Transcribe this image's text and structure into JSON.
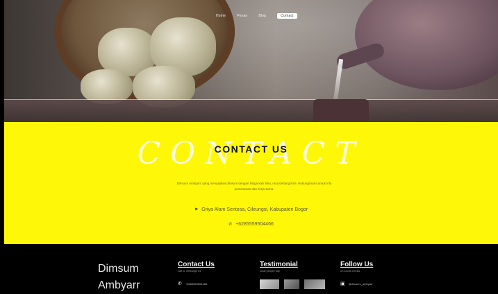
{
  "nav": {
    "items": [
      "Home",
      "Pesan",
      "Blog",
      "Contact"
    ],
    "active": 3
  },
  "contact": {
    "script_text": "CONTACT",
    "title": "CONTACT US",
    "description": "Dimsum Ambyarr, yang menyajikan dimsum dengan harga kaki lima, rasa bintang lima. Hubungi kami untuk info pemesanan dan kerja sama.",
    "address": "Griya Alam Sentosa, Cileungsi, Kabupaten Bogor",
    "phone": "+6285559504466",
    "address_icon": "map-marker-icon",
    "phone_icon": "phone-icon"
  },
  "footer": {
    "brand_line1": "Dimsum",
    "brand_line2": "Ambyarr",
    "contact_heading": "Contact Us",
    "contact_sub": "call or message us",
    "contact_phone": "+6285559504466",
    "testimonial_heading": "Testimonial",
    "testimonial_sub": "what people say",
    "follow_heading": "Follow Us",
    "follow_sub": "on social media",
    "instagram_handle": "@dimsum_ambyarr"
  },
  "colors": {
    "contact_bg": "#fff708",
    "footer_bg": "#000000"
  }
}
